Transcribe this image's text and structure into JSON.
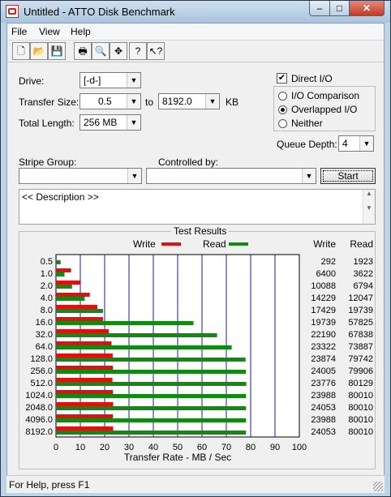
{
  "window": {
    "title": "Untitled - ATTO Disk Benchmark"
  },
  "menu": {
    "file": "File",
    "view": "View",
    "help": "Help"
  },
  "toolbar": {
    "icons": [
      "new-icon",
      "open-icon",
      "save-icon",
      "print-icon",
      "print-preview-icon",
      "move-icon",
      "help-icon",
      "context-help-icon"
    ]
  },
  "form": {
    "drive_label": "Drive:",
    "drive_value": "[-d-]",
    "transfer_size_label": "Transfer Size:",
    "transfer_from": "0.5",
    "to_label": "to",
    "transfer_to": "8192.0",
    "kb_label": "KB",
    "total_length_label": "Total Length:",
    "total_length_value": "256 MB",
    "direct_io_label": "Direct I/O",
    "direct_io_checked": true,
    "io_comparison_label": "I/O Comparison",
    "overlapped_io_label": "Overlapped I/O",
    "neither_label": "Neither",
    "selected_mode": "Overlapped I/O",
    "queue_depth_label": "Queue Depth:",
    "queue_depth_value": "4",
    "stripe_group_label": "Stripe Group:",
    "stripe_group_value": "",
    "controlled_by_label": "Controlled by:",
    "controlled_by_value": "",
    "start_label": "Start",
    "description": "<< Description >>"
  },
  "results": {
    "title": "Test Results",
    "write_legend": "Write",
    "read_legend": "Read",
    "write_col": "Write",
    "read_col": "Read",
    "write_color": "#e01010",
    "read_color": "#108a10"
  },
  "chart_data": {
    "type": "bar",
    "title": "Test Results",
    "xlabel": "Transfer Rate - MB / Sec",
    "ylabel": "",
    "xlim": [
      0,
      100
    ],
    "x_ticks": [
      0,
      10,
      20,
      30,
      40,
      50,
      60,
      70,
      80,
      90,
      100
    ],
    "categories": [
      "0.5",
      "1.0",
      "2.0",
      "4.0",
      "8.0",
      "16.0",
      "32.0",
      "64.0",
      "128.0",
      "256.0",
      "512.0",
      "1024.0",
      "2048.0",
      "4096.0",
      "8192.0"
    ],
    "series": [
      {
        "name": "Write",
        "values": [
          0.3,
          6.2,
          9.9,
          13.9,
          17.0,
          19.3,
          21.7,
          22.8,
          23.3,
          23.4,
          23.2,
          23.4,
          23.5,
          23.4,
          23.5
        ]
      },
      {
        "name": "Read",
        "values": [
          1.9,
          3.5,
          6.6,
          11.8,
          19.3,
          56.5,
          66.2,
          72.2,
          77.9,
          78.0,
          78.2,
          78.1,
          78.1,
          78.1,
          78.1
        ]
      }
    ],
    "write_labels": [
      "292",
      "6400",
      "10088",
      "14229",
      "17429",
      "19739",
      "22190",
      "23322",
      "23874",
      "24005",
      "23776",
      "23988",
      "24053",
      "23988",
      "24053"
    ],
    "read_labels": [
      "1923",
      "3622",
      "6794",
      "12047",
      "19739",
      "57825",
      "67838",
      "73887",
      "79742",
      "79906",
      "80129",
      "80010",
      "80010",
      "80010",
      "80010"
    ],
    "grid": true,
    "legend": "top"
  },
  "status": {
    "text": "For Help, press F1"
  }
}
